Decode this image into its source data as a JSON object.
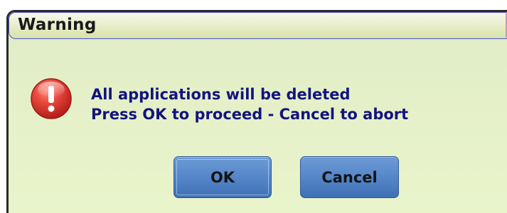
{
  "dialog": {
    "title": "Warning",
    "icon": "warning-exclamation-icon",
    "message_line1": "All applications will be deleted",
    "message_line2": "Press OK to proceed - Cancel to abort",
    "ok_label": "OK",
    "cancel_label": "Cancel",
    "focused_button": "OK"
  },
  "colors": {
    "message_text": "#13137e",
    "button_fill": "#5586c8",
    "dialog_background": "#e6f1c9",
    "icon_red": "#d8312c"
  }
}
